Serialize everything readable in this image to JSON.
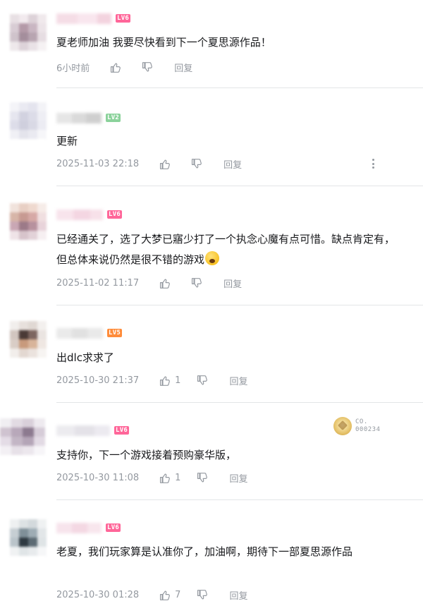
{
  "colors": {
    "lv6": "#ff6699",
    "lv5": "#ff8c3a",
    "lv2": "#8bd29b",
    "text": "#18191c",
    "meta": "#9499a0",
    "divider": "#e3e5e7"
  },
  "actions": {
    "reply_label": "回复"
  },
  "comments": [
    {
      "level": "LV6",
      "text": "夏老师加油 我要尽快看到下一个夏思源作品！",
      "time": "6小时前",
      "likes": ""
    },
    {
      "level": "LV2",
      "text": "更新",
      "time": "2025-11-03 22:18",
      "likes": ""
    },
    {
      "level": "LV6",
      "text": "已经通关了，选了大梦已寤少打了一个执念心魔有点可惜。缺点肯定有，但总体来说仍然是很不错的游戏",
      "time": "2025-11-02 11:17",
      "likes": ""
    },
    {
      "level": "LV5",
      "text": "出dlc求求了",
      "time": "2025-10-30 21:37",
      "likes": "1"
    },
    {
      "level": "LV6",
      "text": "支持你，下一个游戏接着预购豪华版，",
      "time": "2025-10-30 11:08",
      "likes": "1"
    },
    {
      "level": "LV6",
      "text": "老夏，我们玩家算是认准你了，加油啊，期待下一部夏思源作品",
      "time": "2025-10-30 01:28",
      "likes": "7"
    }
  ],
  "fan_badge": {
    "line1": "CO.",
    "line2": "000234",
    "icon": "medal-icon"
  }
}
